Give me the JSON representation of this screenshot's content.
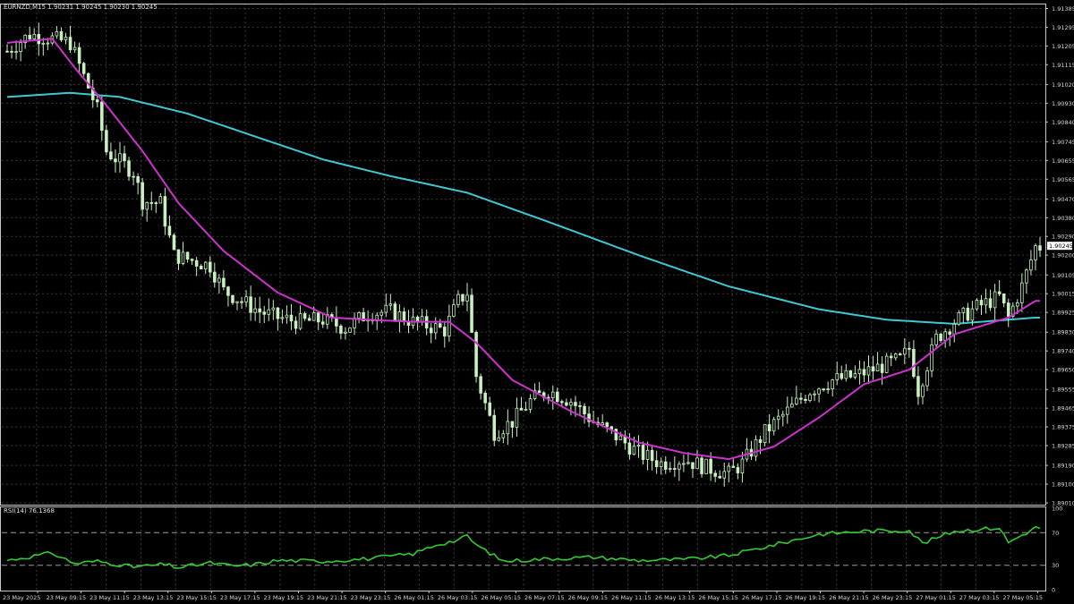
{
  "main_header": "EURNZD,M15  1.90231 1.90245 1.90230 1.90245",
  "rsi_header": "RSI(14) 76.1368",
  "current_price_label": "1.90245",
  "colors": {
    "background": "#000000",
    "grid": "#3a3a3a",
    "candle": "#c8f0c0",
    "ma_fast": "#cc33cc",
    "ma_slow": "#40c8d0",
    "rsi_line": "#33cc33",
    "axis_text": "#d8d8d8"
  },
  "chart_data": [
    {
      "type": "candlestick",
      "symbol": "EURNZD",
      "timeframe": "M15",
      "ylim": [
        1.8901,
        1.914
      ],
      "y_ticks": [
        "1.91385",
        "1.91295",
        "1.91205",
        "1.91115",
        "1.91020",
        "1.90930",
        "1.90840",
        "1.90745",
        "1.90655",
        "1.90565",
        "1.90470",
        "1.90380",
        "1.90290",
        "1.90200",
        "1.90105",
        "1.90015",
        "1.89925",
        "1.89830",
        "1.89740",
        "1.89650",
        "1.89555",
        "1.89465",
        "1.89375",
        "1.89285",
        "1.89190",
        "1.89100",
        "1.89010"
      ],
      "x_ticks": [
        "23 May 2025",
        "23 May 09:15",
        "23 May 11:15",
        "23 May 13:15",
        "23 May 15:15",
        "23 May 17:15",
        "23 May 19:15",
        "23 May 21:15",
        "23 May 23:15",
        "26 May 01:15",
        "26 May 03:15",
        "26 May 05:15",
        "26 May 07:15",
        "26 May 09:15",
        "26 May 11:15",
        "26 May 13:15",
        "26 May 15:15",
        "26 May 17:15",
        "26 May 19:15",
        "26 May 21:15",
        "26 May 23:15",
        "27 May 01:15",
        "27 May 03:15",
        "27 May 05:15"
      ],
      "close_path": [
        [
          0,
          1.9118
        ],
        [
          5,
          1.9126
        ],
        [
          10,
          1.9124
        ],
        [
          14,
          1.9122
        ],
        [
          20,
          1.909
        ],
        [
          22,
          1.907
        ],
        [
          28,
          1.906
        ],
        [
          30,
          1.9046
        ],
        [
          34,
          1.9045
        ],
        [
          37,
          1.902
        ],
        [
          45,
          1.9015
        ],
        [
          48,
          1.9003
        ],
        [
          52,
          1.8998
        ],
        [
          56,
          1.8993
        ],
        [
          60,
          1.899
        ],
        [
          65,
          1.8988
        ],
        [
          70,
          1.8989
        ],
        [
          75,
          1.8985
        ],
        [
          80,
          1.8992
        ],
        [
          85,
          1.8993
        ],
        [
          90,
          1.8988
        ],
        [
          97,
          1.8984
        ],
        [
          100,
          1.8998
        ],
        [
          102,
          1.9002
        ],
        [
          104,
          1.8962
        ],
        [
          108,
          1.8935
        ],
        [
          112,
          1.894
        ],
        [
          116,
          1.895
        ],
        [
          120,
          1.8955
        ],
        [
          125,
          1.895
        ],
        [
          130,
          1.894
        ],
        [
          135,
          1.8933
        ],
        [
          140,
          1.8925
        ],
        [
          145,
          1.892
        ],
        [
          150,
          1.8922
        ],
        [
          155,
          1.8918
        ],
        [
          160,
          1.8915
        ],
        [
          163,
          1.892
        ],
        [
          168,
          1.8935
        ],
        [
          173,
          1.8945
        ],
        [
          178,
          1.8955
        ],
        [
          183,
          1.896
        ],
        [
          188,
          1.8962
        ],
        [
          193,
          1.8966
        ],
        [
          198,
          1.897
        ],
        [
          200,
          1.8975
        ],
        [
          202,
          1.8955
        ],
        [
          206,
          1.898
        ],
        [
          210,
          1.8988
        ],
        [
          215,
          1.8995
        ],
        [
          220,
          1.9
        ],
        [
          222,
          1.899
        ],
        [
          225,
          1.9005
        ],
        [
          228,
          1.9024
        ]
      ],
      "wick_range": 0.0006,
      "ma_fast_path": [
        [
          0,
          1.9122
        ],
        [
          10,
          1.9124
        ],
        [
          15,
          1.911
        ],
        [
          22,
          1.9092
        ],
        [
          30,
          1.907
        ],
        [
          38,
          1.9045
        ],
        [
          48,
          1.9022
        ],
        [
          60,
          1.9002
        ],
        [
          72,
          1.899
        ],
        [
          80,
          1.8989
        ],
        [
          90,
          1.8988
        ],
        [
          98,
          1.8988
        ],
        [
          104,
          1.8978
        ],
        [
          112,
          1.896
        ],
        [
          125,
          1.8945
        ],
        [
          140,
          1.893
        ],
        [
          150,
          1.8925
        ],
        [
          160,
          1.8922
        ],
        [
          170,
          1.8928
        ],
        [
          180,
          1.8942
        ],
        [
          190,
          1.8958
        ],
        [
          200,
          1.8965
        ],
        [
          210,
          1.8982
        ],
        [
          222,
          1.899
        ],
        [
          228,
          1.8998
        ]
      ],
      "ma_slow_path": [
        [
          0,
          1.9096
        ],
        [
          14,
          1.9098
        ],
        [
          25,
          1.9096
        ],
        [
          40,
          1.9088
        ],
        [
          55,
          1.9077
        ],
        [
          70,
          1.9066
        ],
        [
          85,
          1.9058
        ],
        [
          102,
          1.905
        ],
        [
          120,
          1.9036
        ],
        [
          140,
          1.902
        ],
        [
          160,
          1.9005
        ],
        [
          180,
          1.8994
        ],
        [
          195,
          1.8989
        ],
        [
          210,
          1.8987
        ],
        [
          228,
          1.899
        ]
      ]
    },
    {
      "type": "line",
      "name": "RSI(14)",
      "ylim": [
        0,
        100
      ],
      "y_ticks": [
        100,
        70,
        30,
        0
      ],
      "levels": [
        70,
        30
      ],
      "values_path": [
        [
          0,
          36
        ],
        [
          10,
          45
        ],
        [
          15,
          32
        ],
        [
          20,
          35
        ],
        [
          28,
          28
        ],
        [
          35,
          31
        ],
        [
          38,
          27
        ],
        [
          45,
          33
        ],
        [
          50,
          29
        ],
        [
          55,
          31
        ],
        [
          60,
          36
        ],
        [
          70,
          35
        ],
        [
          80,
          38
        ],
        [
          90,
          44
        ],
        [
          95,
          55
        ],
        [
          100,
          61
        ],
        [
          102,
          66
        ],
        [
          104,
          55
        ],
        [
          110,
          35
        ],
        [
          120,
          38
        ],
        [
          130,
          40
        ],
        [
          140,
          36
        ],
        [
          150,
          37
        ],
        [
          160,
          42
        ],
        [
          170,
          55
        ],
        [
          180,
          68
        ],
        [
          190,
          72
        ],
        [
          200,
          73
        ],
        [
          203,
          57
        ],
        [
          210,
          72
        ],
        [
          220,
          76
        ],
        [
          222,
          58
        ],
        [
          228,
          76
        ]
      ],
      "current": 76.1368
    }
  ]
}
